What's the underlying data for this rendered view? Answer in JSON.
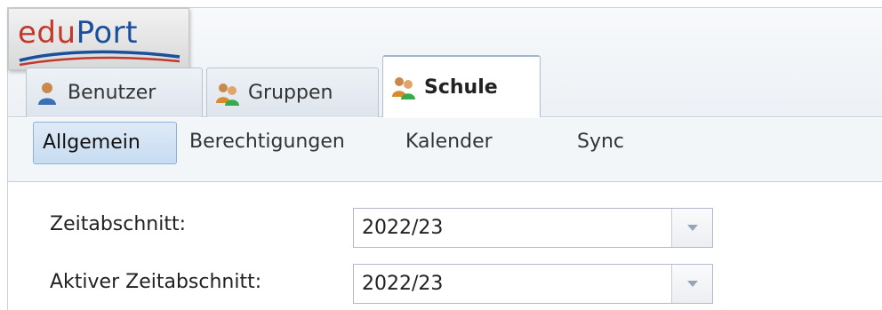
{
  "app": {
    "logo_part1": "edu",
    "logo_part2": "Port"
  },
  "tabs": [
    {
      "label": "Benutzer",
      "icon": "user-icon",
      "active": false
    },
    {
      "label": "Gruppen",
      "icon": "group-icon",
      "active": false
    },
    {
      "label": "Schule",
      "icon": "school-icon",
      "active": true
    }
  ],
  "subtabs": [
    {
      "label": "Allgemein",
      "active": true
    },
    {
      "label": "Berechtigungen",
      "active": false
    },
    {
      "label": "Kalender",
      "active": false
    },
    {
      "label": "Sync",
      "active": false
    }
  ],
  "form": {
    "zeitabschnitt": {
      "label": "Zeitabschnitt:",
      "value": "2022/23"
    },
    "aktiver_zeitabschnitt": {
      "label": "Aktiver Zeitabschnitt:",
      "value": "2022/23"
    }
  },
  "colors": {
    "accent": "#1a4f9b",
    "logo_red": "#c0392b",
    "active_subtab": "#c7dcf2"
  }
}
